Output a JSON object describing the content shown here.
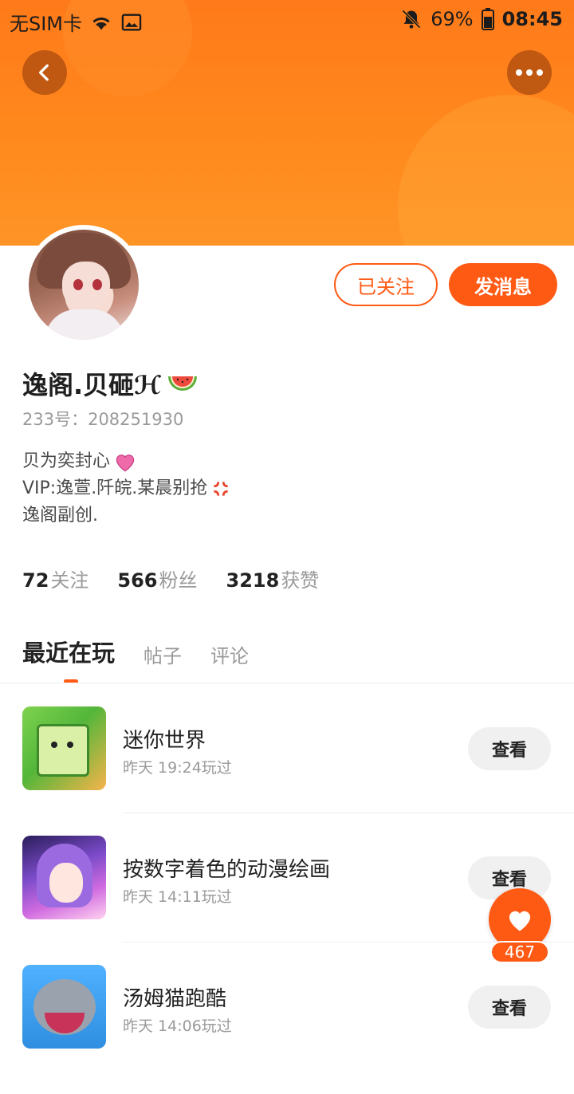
{
  "status_bar": {
    "carrier": "无SIM卡",
    "battery": "69%",
    "time": "08:45",
    "icons": [
      "wifi-icon",
      "image-icon",
      "mute-bell-icon",
      "battery-icon"
    ]
  },
  "header": {
    "back_icon": "chevron-left-icon",
    "more_icon": "more-dots-icon",
    "accent_color": "#ff7a1a"
  },
  "profile": {
    "name": "逸阁.贝砸ℋ",
    "name_emoji": "watermelon-icon",
    "uid": "233号：208251930",
    "bio": [
      {
        "text": "贝为奕封心",
        "emoji": "pink-heart-icon"
      },
      {
        "text": "VIP:逸萱.阡皖.某晨别抢",
        "emoji": "anger-icon"
      },
      {
        "text": "逸阁副创.",
        "emoji": ""
      }
    ],
    "follow_label": "已关注",
    "message_label": "发消息"
  },
  "stats": [
    {
      "num": "72",
      "label": "关注"
    },
    {
      "num": "566",
      "label": "粉丝"
    },
    {
      "num": "3218",
      "label": "获赞"
    }
  ],
  "tabs": [
    {
      "label": "最近在玩",
      "active": true
    },
    {
      "label": "帖子",
      "active": false
    },
    {
      "label": "评论",
      "active": false
    }
  ],
  "games": [
    {
      "title": "迷你世界",
      "time": "昨天 19:24玩过",
      "button": "查看"
    },
    {
      "title": "按数字着色的动漫绘画",
      "time": "昨天 14:11玩过",
      "button": "查看"
    },
    {
      "title": "汤姆猫跑酷",
      "time": "昨天 14:06玩过",
      "button": "查看"
    }
  ],
  "like": {
    "count": "467",
    "icon": "heart-icon"
  }
}
